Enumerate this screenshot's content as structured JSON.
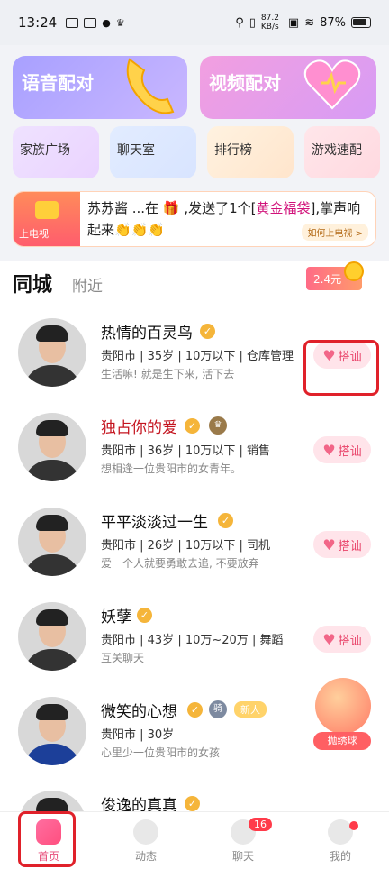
{
  "status_bar": {
    "time": "13:24",
    "net_speed": "87.2 KB/s",
    "battery": "87%"
  },
  "entries": {
    "voice_match": "语音配对",
    "video_match": "视频配对",
    "family_square": "家族广场",
    "chat_room": "聊天室",
    "leaderboard": "排行榜",
    "game_match": "游戏速配"
  },
  "tv_banner": {
    "label": "上电视",
    "msg_part1": "苏苏酱 ...在",
    "msg_part2": ",发送了1个[",
    "gift": "黄金福袋",
    "msg_part3": "],掌声响起来👏👏👏",
    "how": "如何上电视 >"
  },
  "tabs": {
    "same_city": "同城",
    "nearby": "附近"
  },
  "reward": "2.4元",
  "users": [
    {
      "name": "热情的百灵鸟",
      "info": "贵阳市 | 35岁 | 10万以下 | 仓库管理",
      "sub": "生活嘛! 就是生下来, 活下去",
      "action": "搭讪"
    },
    {
      "name": "独占你的爱",
      "info": "贵阳市 | 36岁 | 10万以下 | 销售",
      "sub": "想相逢一位贵阳市的女青年。",
      "action": "搭讪"
    },
    {
      "name": "平平淡淡过一生",
      "info": "贵阳市 | 26岁 | 10万以下 | 司机",
      "sub": "爱一个人就要勇敢去追, 不要放弃",
      "action": "搭讪"
    },
    {
      "name": "妖孽",
      "info": "贵阳市 | 43岁 | 10万~20万 | 舞蹈",
      "sub": "互关聊天",
      "action": "搭讪"
    },
    {
      "name": "微笑的心想",
      "info": "贵阳市 | 30岁",
      "sub": "心里少一位贵阳市的女孩",
      "badge_level": "骑",
      "badge_new": "新人"
    },
    {
      "name": "俊逸的真真"
    }
  ],
  "floating_ball": "抛绣球",
  "nav": {
    "home": "首页",
    "moments": "动态",
    "chat": "聊天",
    "chat_badge": "16",
    "me": "我的"
  }
}
